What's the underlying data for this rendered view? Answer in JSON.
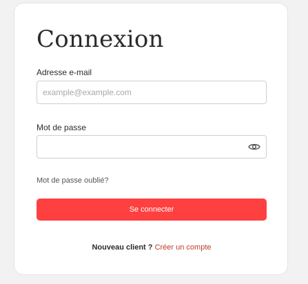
{
  "login": {
    "title": "Connexion",
    "email_label": "Adresse e-mail",
    "email_value": "",
    "email_placeholder": "example@example.com",
    "password_label": "Mot de passe",
    "password_value": "",
    "password_toggle_icon": "eye-icon",
    "forgot_password": "Mot de passe oublié?",
    "submit_label": "Se connecter",
    "new_client_prompt": "Nouveau client ?",
    "create_account_link": "Créer un compte"
  },
  "colors": {
    "background": "#f2f2f2",
    "card": "#ffffff",
    "primary_button": "#ff4040",
    "link_accent": "#c0392b",
    "text": "#2b2b2b"
  }
}
